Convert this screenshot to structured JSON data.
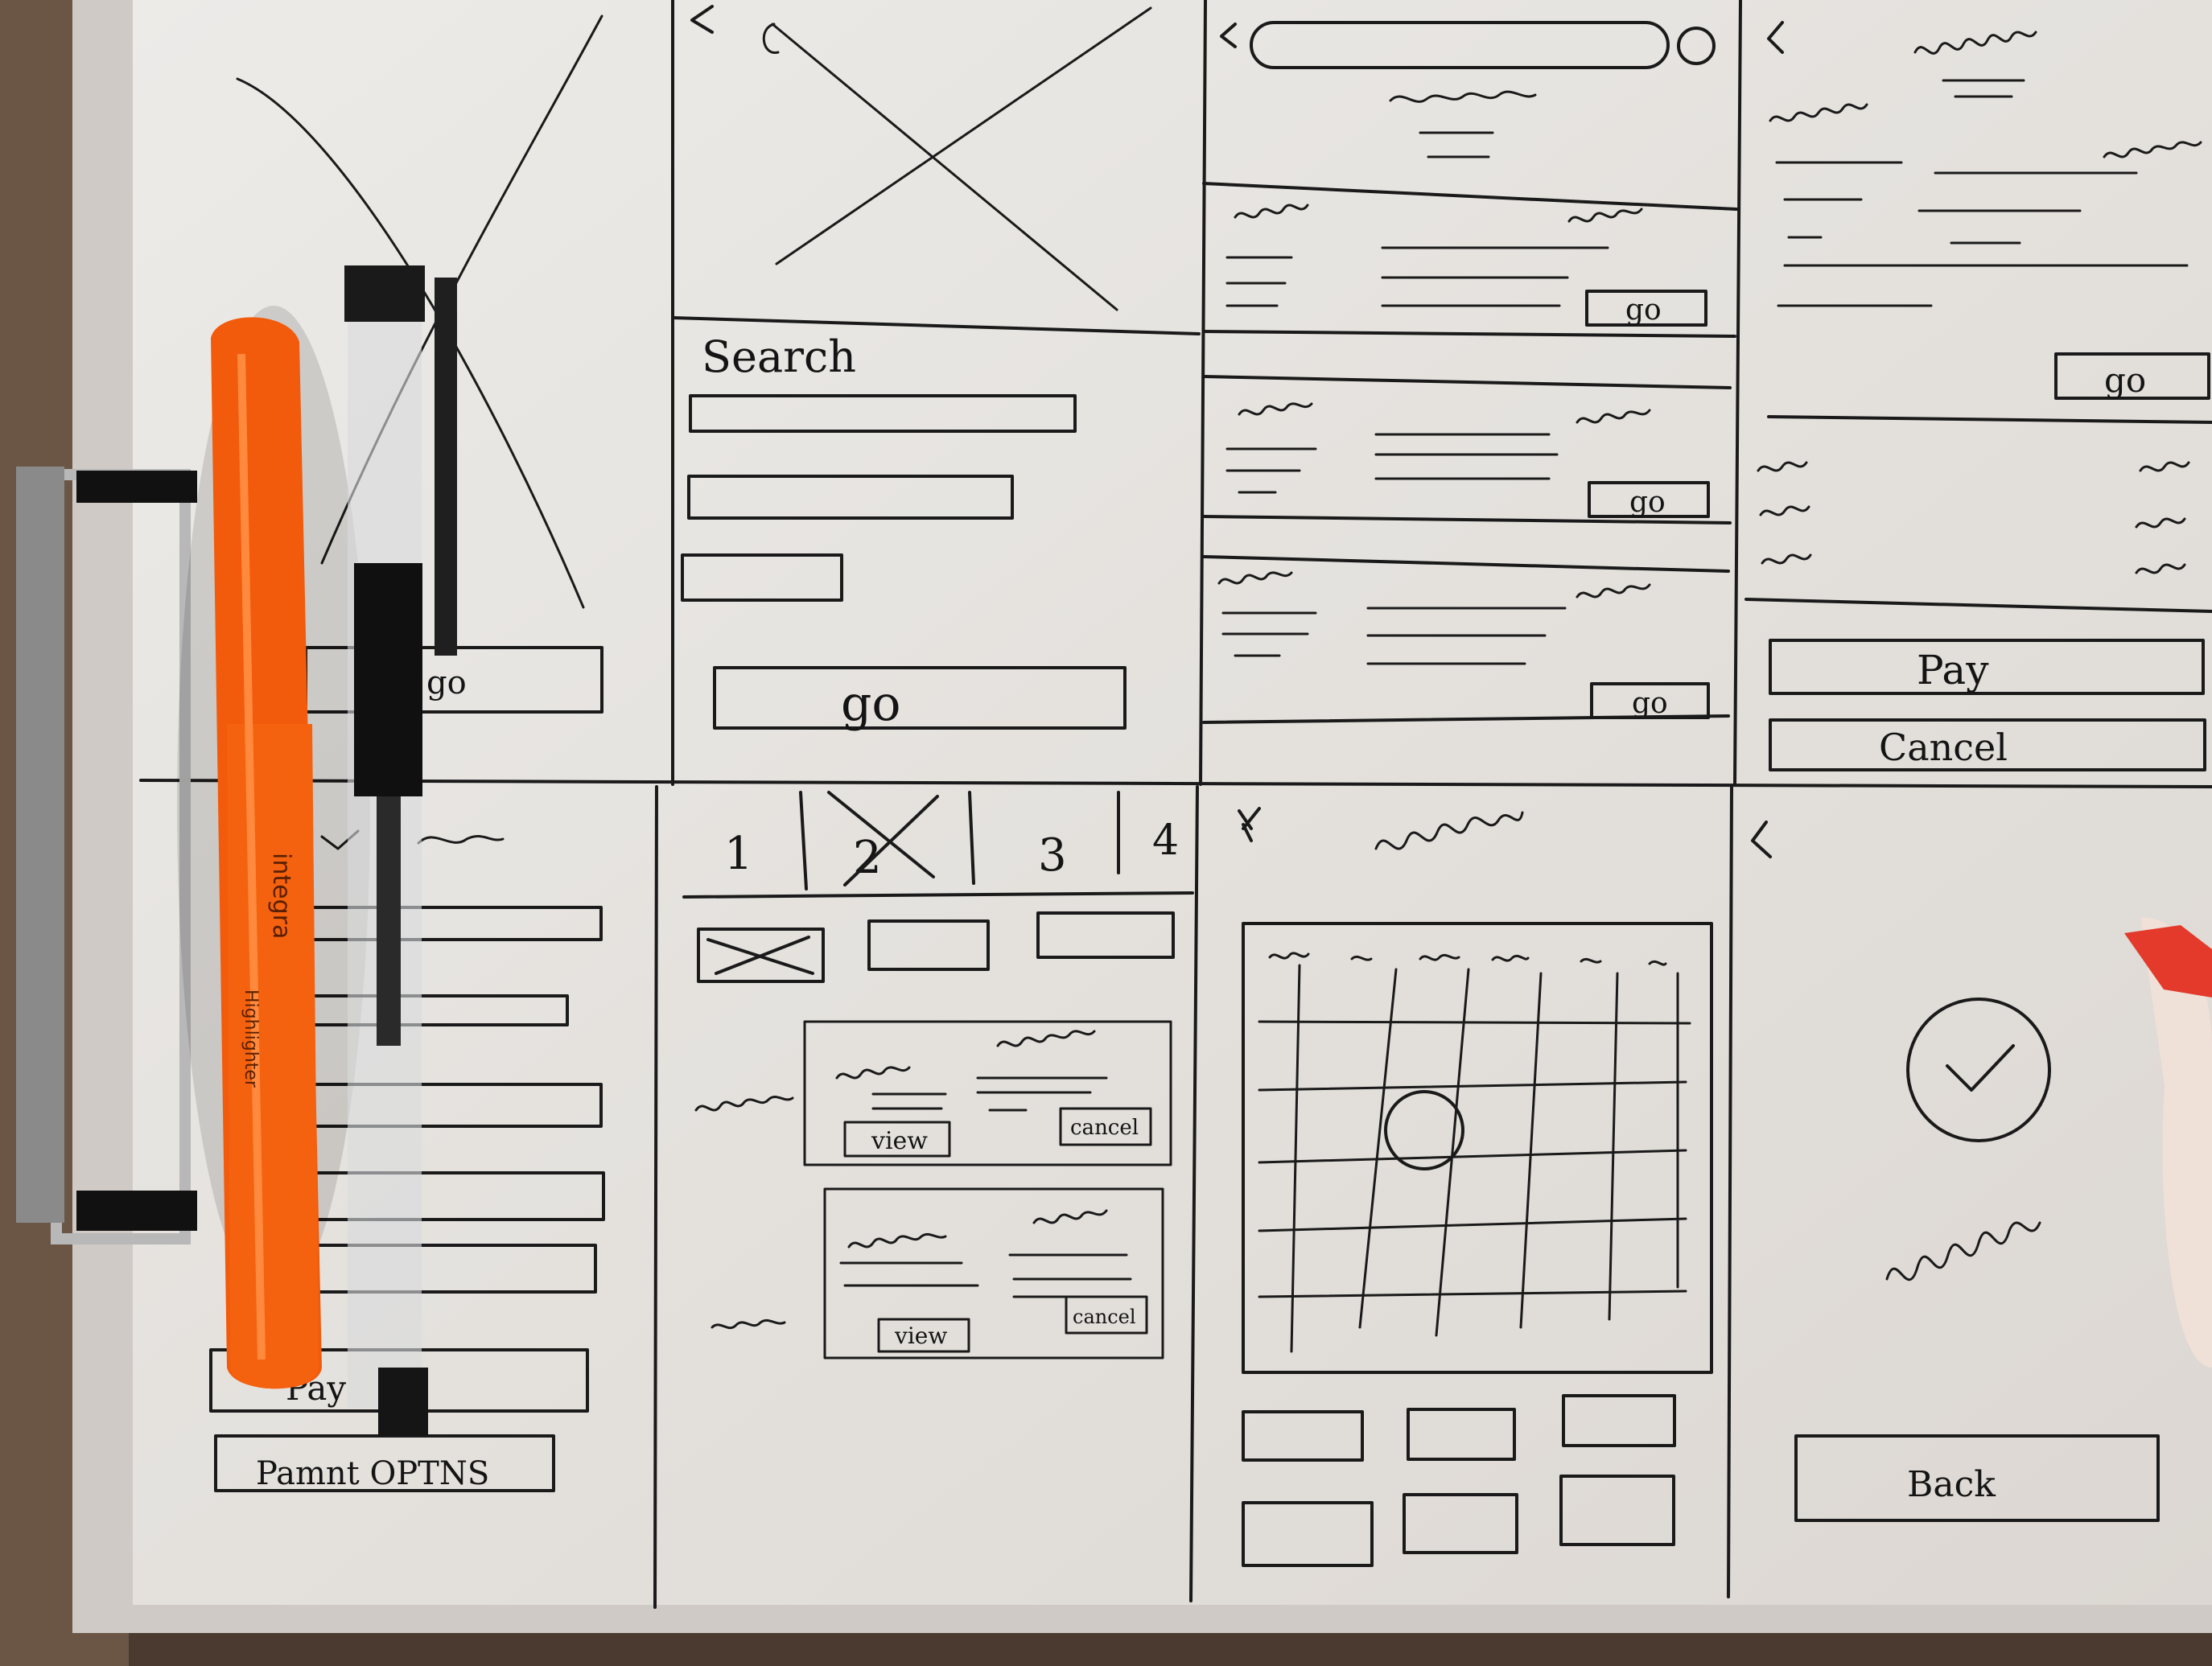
{
  "screens": {
    "home": {
      "go_label": "go",
      "pay_label": "Pay",
      "payment_options_label": "Pamnt OPTNS"
    },
    "search": {
      "heading": "Search",
      "go_label": "go"
    },
    "results": {
      "go_labels": [
        "go",
        "go",
        "go"
      ]
    },
    "detail": {
      "go_label": "go",
      "pay_label": "Pay",
      "cancel_label": "Cancel"
    },
    "tabs": {
      "tab_labels": [
        "1",
        "2",
        "3",
        "4"
      ],
      "view_labels": [
        "view",
        "view"
      ],
      "cancel_labels": [
        "cancel",
        "cancel"
      ]
    },
    "calendar": {},
    "confirmation": {
      "back_label": "Back"
    }
  },
  "desk": {
    "highlighter_brand": "integra",
    "highlighter_caption": "Highlighter"
  },
  "colors": {
    "paper": "#e9e6e3",
    "ink": "#1a1a1a",
    "highlighter": "#f25a0c",
    "desk": "#4a3a30"
  },
  "icons": [
    "back-arrow-icon",
    "image-placeholder-icon",
    "search-icon",
    "check-circle-icon",
    "close-icon"
  ]
}
